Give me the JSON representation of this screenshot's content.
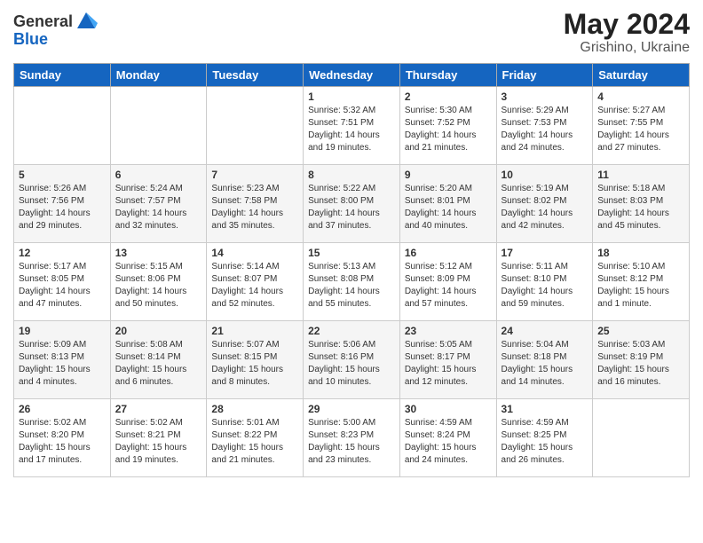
{
  "header": {
    "logo_general": "General",
    "logo_blue": "Blue",
    "month_year": "May 2024",
    "location": "Grishino, Ukraine"
  },
  "days_of_week": [
    "Sunday",
    "Monday",
    "Tuesday",
    "Wednesday",
    "Thursday",
    "Friday",
    "Saturday"
  ],
  "weeks": [
    [
      {
        "day": "",
        "info": ""
      },
      {
        "day": "",
        "info": ""
      },
      {
        "day": "",
        "info": ""
      },
      {
        "day": "1",
        "info": "Sunrise: 5:32 AM\nSunset: 7:51 PM\nDaylight: 14 hours\nand 19 minutes."
      },
      {
        "day": "2",
        "info": "Sunrise: 5:30 AM\nSunset: 7:52 PM\nDaylight: 14 hours\nand 21 minutes."
      },
      {
        "day": "3",
        "info": "Sunrise: 5:29 AM\nSunset: 7:53 PM\nDaylight: 14 hours\nand 24 minutes."
      },
      {
        "day": "4",
        "info": "Sunrise: 5:27 AM\nSunset: 7:55 PM\nDaylight: 14 hours\nand 27 minutes."
      }
    ],
    [
      {
        "day": "5",
        "info": "Sunrise: 5:26 AM\nSunset: 7:56 PM\nDaylight: 14 hours\nand 29 minutes."
      },
      {
        "day": "6",
        "info": "Sunrise: 5:24 AM\nSunset: 7:57 PM\nDaylight: 14 hours\nand 32 minutes."
      },
      {
        "day": "7",
        "info": "Sunrise: 5:23 AM\nSunset: 7:58 PM\nDaylight: 14 hours\nand 35 minutes."
      },
      {
        "day": "8",
        "info": "Sunrise: 5:22 AM\nSunset: 8:00 PM\nDaylight: 14 hours\nand 37 minutes."
      },
      {
        "day": "9",
        "info": "Sunrise: 5:20 AM\nSunset: 8:01 PM\nDaylight: 14 hours\nand 40 minutes."
      },
      {
        "day": "10",
        "info": "Sunrise: 5:19 AM\nSunset: 8:02 PM\nDaylight: 14 hours\nand 42 minutes."
      },
      {
        "day": "11",
        "info": "Sunrise: 5:18 AM\nSunset: 8:03 PM\nDaylight: 14 hours\nand 45 minutes."
      }
    ],
    [
      {
        "day": "12",
        "info": "Sunrise: 5:17 AM\nSunset: 8:05 PM\nDaylight: 14 hours\nand 47 minutes."
      },
      {
        "day": "13",
        "info": "Sunrise: 5:15 AM\nSunset: 8:06 PM\nDaylight: 14 hours\nand 50 minutes."
      },
      {
        "day": "14",
        "info": "Sunrise: 5:14 AM\nSunset: 8:07 PM\nDaylight: 14 hours\nand 52 minutes."
      },
      {
        "day": "15",
        "info": "Sunrise: 5:13 AM\nSunset: 8:08 PM\nDaylight: 14 hours\nand 55 minutes."
      },
      {
        "day": "16",
        "info": "Sunrise: 5:12 AM\nSunset: 8:09 PM\nDaylight: 14 hours\nand 57 minutes."
      },
      {
        "day": "17",
        "info": "Sunrise: 5:11 AM\nSunset: 8:10 PM\nDaylight: 14 hours\nand 59 minutes."
      },
      {
        "day": "18",
        "info": "Sunrise: 5:10 AM\nSunset: 8:12 PM\nDaylight: 15 hours\nand 1 minute."
      }
    ],
    [
      {
        "day": "19",
        "info": "Sunrise: 5:09 AM\nSunset: 8:13 PM\nDaylight: 15 hours\nand 4 minutes."
      },
      {
        "day": "20",
        "info": "Sunrise: 5:08 AM\nSunset: 8:14 PM\nDaylight: 15 hours\nand 6 minutes."
      },
      {
        "day": "21",
        "info": "Sunrise: 5:07 AM\nSunset: 8:15 PM\nDaylight: 15 hours\nand 8 minutes."
      },
      {
        "day": "22",
        "info": "Sunrise: 5:06 AM\nSunset: 8:16 PM\nDaylight: 15 hours\nand 10 minutes."
      },
      {
        "day": "23",
        "info": "Sunrise: 5:05 AM\nSunset: 8:17 PM\nDaylight: 15 hours\nand 12 minutes."
      },
      {
        "day": "24",
        "info": "Sunrise: 5:04 AM\nSunset: 8:18 PM\nDaylight: 15 hours\nand 14 minutes."
      },
      {
        "day": "25",
        "info": "Sunrise: 5:03 AM\nSunset: 8:19 PM\nDaylight: 15 hours\nand 16 minutes."
      }
    ],
    [
      {
        "day": "26",
        "info": "Sunrise: 5:02 AM\nSunset: 8:20 PM\nDaylight: 15 hours\nand 17 minutes."
      },
      {
        "day": "27",
        "info": "Sunrise: 5:02 AM\nSunset: 8:21 PM\nDaylight: 15 hours\nand 19 minutes."
      },
      {
        "day": "28",
        "info": "Sunrise: 5:01 AM\nSunset: 8:22 PM\nDaylight: 15 hours\nand 21 minutes."
      },
      {
        "day": "29",
        "info": "Sunrise: 5:00 AM\nSunset: 8:23 PM\nDaylight: 15 hours\nand 23 minutes."
      },
      {
        "day": "30",
        "info": "Sunrise: 4:59 AM\nSunset: 8:24 PM\nDaylight: 15 hours\nand 24 minutes."
      },
      {
        "day": "31",
        "info": "Sunrise: 4:59 AM\nSunset: 8:25 PM\nDaylight: 15 hours\nand 26 minutes."
      },
      {
        "day": "",
        "info": ""
      }
    ]
  ]
}
